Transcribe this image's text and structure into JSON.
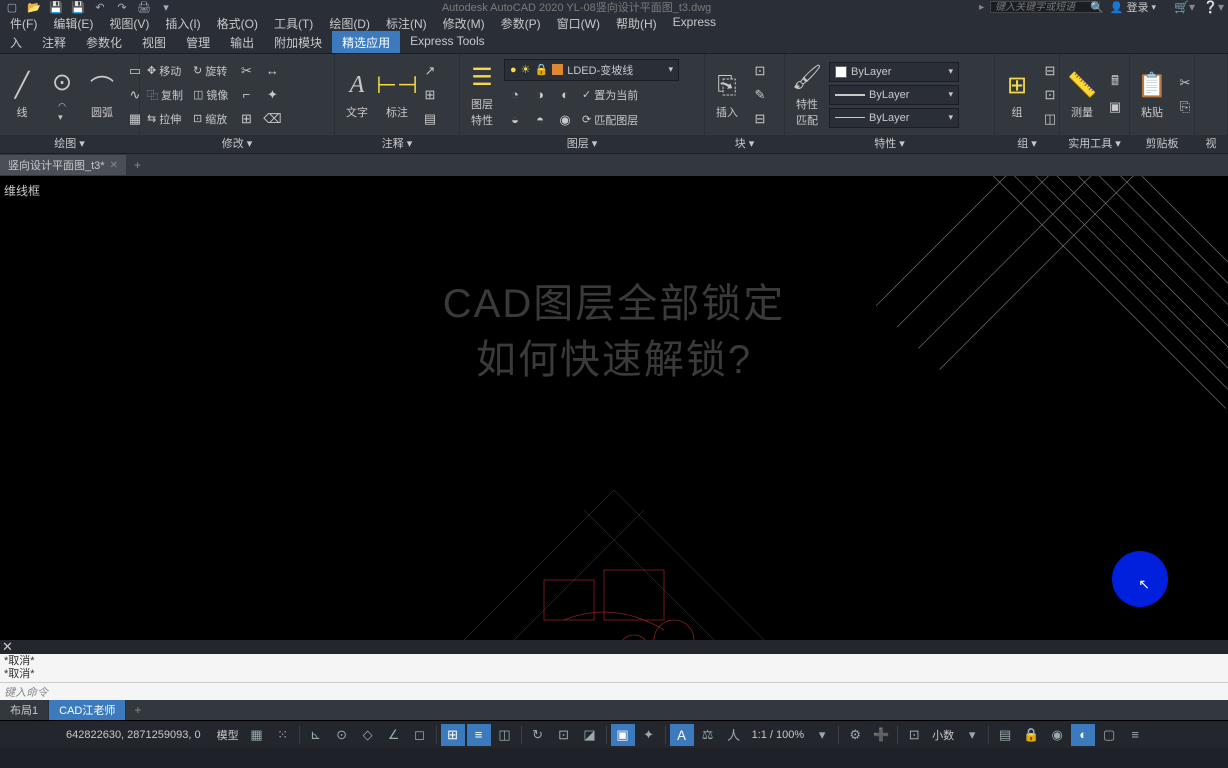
{
  "title": "Autodesk AutoCAD 2020    YL-08竖向设计平面图_t3.dwg",
  "search_placeholder": "键入关键字或短语",
  "user_label": "登录",
  "menu": [
    "件(F)",
    "编辑(E)",
    "视图(V)",
    "插入(I)",
    "格式(O)",
    "工具(T)",
    "绘图(D)",
    "标注(N)",
    "修改(M)",
    "参数(P)",
    "窗口(W)",
    "帮助(H)",
    "Express"
  ],
  "ribbon_tabs": [
    "入",
    "注释",
    "参数化",
    "视图",
    "管理",
    "输出",
    "附加模块",
    "精选应用",
    "Express Tools"
  ],
  "panels": {
    "draw": {
      "line": "线",
      "arc": "圆弧",
      "title": "绘图 ▾"
    },
    "modify": {
      "move": "移动",
      "rotate": "旋转",
      "copy": "复制",
      "mirror": "镜像",
      "stretch": "拉伸",
      "scale": "缩放",
      "title": "修改 ▾"
    },
    "annot": {
      "text": "文字",
      "dim": "标注",
      "title": "注释 ▾"
    },
    "layers": {
      "props": "图层\n特性",
      "combo": "LDED-变坡线",
      "setcurrent": "置为当前",
      "match": "匹配图层",
      "title": "图层 ▾"
    },
    "block": {
      "insert": "插入",
      "title": "块 ▾"
    },
    "props": {
      "match": "特性\n匹配",
      "bylayer1": "ByLayer",
      "bylayer2": "ByLayer",
      "bylayer3": "ByLayer",
      "title": "特性 ▾"
    },
    "group": {
      "group": "组",
      "title": "组 ▾"
    },
    "util": {
      "measure": "测量",
      "title": "实用工具 ▾"
    },
    "clip": {
      "paste": "粘贴",
      "title": "剪贴板"
    },
    "view": {
      "title": "视"
    }
  },
  "file_tab": "竖向设计平面图_t3*",
  "canvas_label": "维线框",
  "overlay_line1": "CAD图层全部锁定",
  "overlay_line2": "如何快速解锁?",
  "cmd_history": [
    "*取消*",
    "*取消*"
  ],
  "cmd_prompt": "键入命令",
  "layout_tabs": [
    "布局1",
    "CAD江老师"
  ],
  "status": {
    "coords": "642822630, 2871259093, 0",
    "model": "模型",
    "scale": "1:1 / 100%",
    "decimal": "小数"
  }
}
